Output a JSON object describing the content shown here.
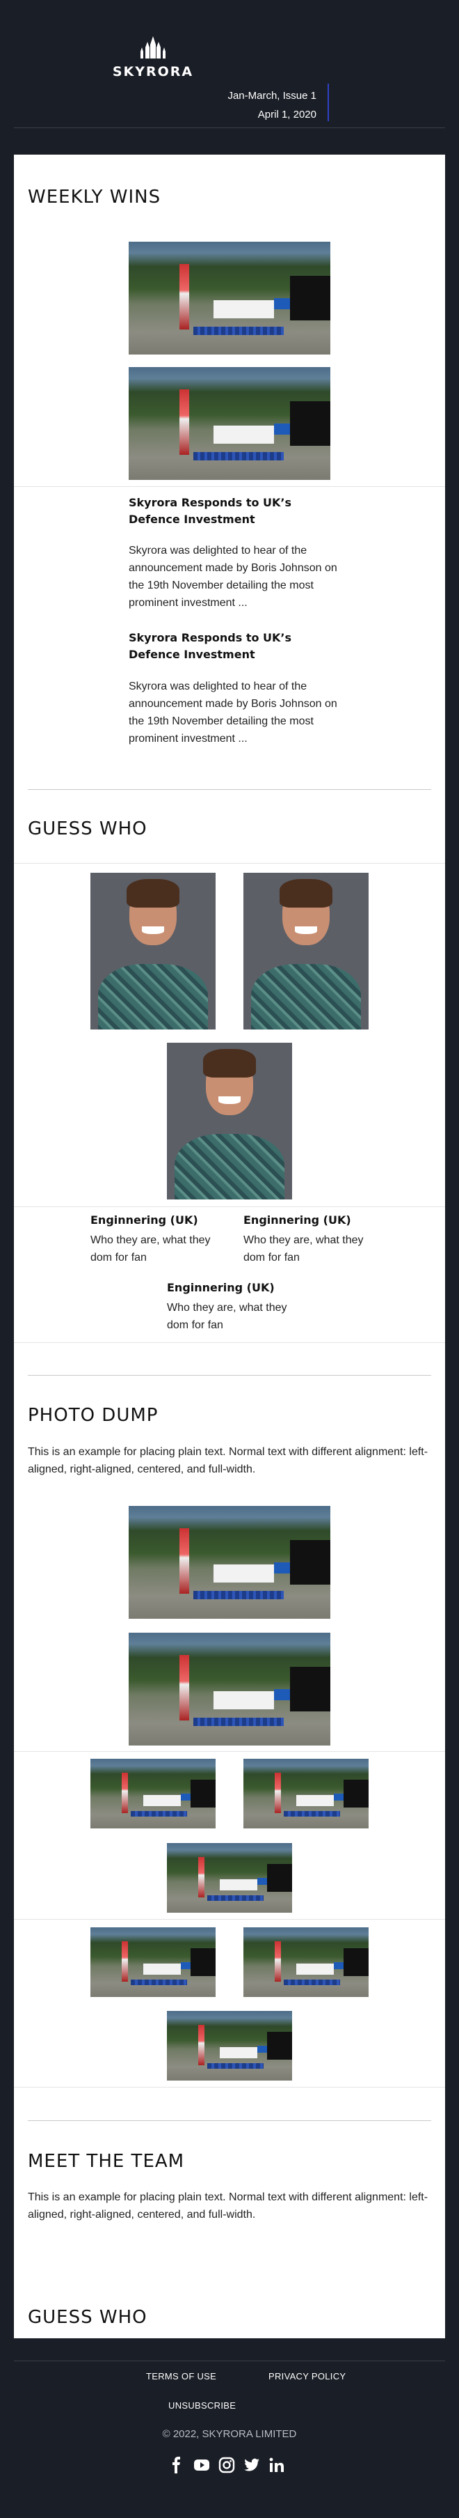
{
  "header": {
    "logo_text": "SKYRORA",
    "issue": "Jan-March, Issue 1",
    "date": "April 1, 2020"
  },
  "weekly_wins": {
    "title": "WEEKLY WINS",
    "articles": [
      {
        "title": "Skyrora Responds to UK’s Defence Investment",
        "text": "Skyrora was delighted to hear of the announcement made by Boris Johnson on the 19th November detailing the most prominent investment ..."
      },
      {
        "title": "Skyrora Responds to UK’s Defence Investment",
        "text": "Skyrora was delighted to hear of the announcement made by Boris Johnson on the 19th November detailing the most prominent investment ..."
      }
    ]
  },
  "guess_who": {
    "title": "GUESS  WHO",
    "people": [
      {
        "role": "Enginnering (UK)",
        "desc": "Who they are, what they dom for fan"
      },
      {
        "role": "Enginnering (UK)",
        "desc": "Who they are, what they dom for fan"
      },
      {
        "role": "Enginnering (UK)",
        "desc": "Who they are, what they dom for fan"
      }
    ]
  },
  "photo_dump": {
    "title": "PHOTO DUMP",
    "text": "This is an example for placing plain text. Normal text with different alignment: left-aligned, right-aligned, centered, and full-width."
  },
  "meet_team": {
    "title": "MEET THE TEAM",
    "text": "This is an example for placing plain text. Normal text with different alignment: left-aligned, right-aligned, centered, and full-width."
  },
  "guess_who_2": {
    "title": "GUESS  WHO"
  },
  "footer": {
    "terms": "TERMS OF USE",
    "privacy": "PRIVACY POLICY",
    "unsubscribe": "UNSUBSCRIBE",
    "copyright": "© 2022, SKYRORA LIMITED",
    "social_icons": [
      "facebook-icon",
      "youtube-icon",
      "instagram-icon",
      "twitter-icon",
      "linkedin-icon"
    ]
  },
  "colors": {
    "background": "#1a1e26",
    "card": "#ffffff",
    "accent_bar": "#2f41c8"
  }
}
